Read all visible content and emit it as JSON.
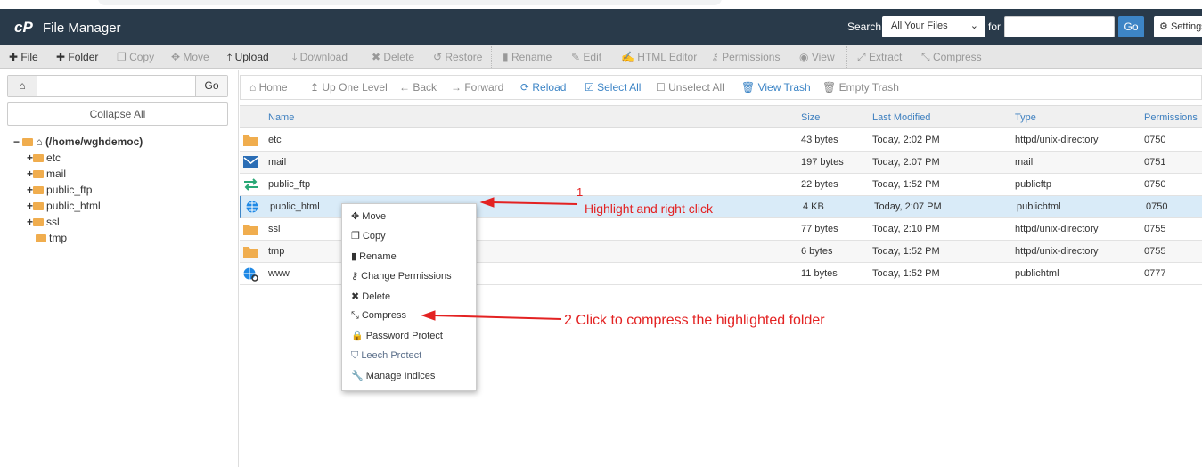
{
  "header": {
    "title": "File Manager",
    "logo": "cP",
    "search_label": "Search",
    "search_scope": "All Your Files",
    "for_label": "for",
    "search_value": "",
    "go": "Go",
    "settings": "Settings"
  },
  "toolbar": [
    {
      "icon": "plus-icon",
      "label": "File",
      "enabled": true
    },
    {
      "icon": "plus-icon",
      "label": "Folder",
      "enabled": true
    },
    {
      "icon": "copy-icon",
      "label": "Copy",
      "enabled": false
    },
    {
      "icon": "move-icon",
      "label": "Move",
      "enabled": false
    },
    {
      "icon": "upload-icon",
      "label": "Upload",
      "enabled": true
    },
    {
      "icon": "download-icon",
      "label": "Download",
      "enabled": false
    },
    {
      "icon": "delete-icon",
      "label": "Delete",
      "enabled": false
    },
    {
      "icon": "restore-icon",
      "label": "Restore",
      "enabled": false
    },
    {
      "icon": "rename-icon",
      "label": "Rename",
      "enabled": false
    },
    {
      "icon": "edit-icon",
      "label": "Edit",
      "enabled": false
    },
    {
      "icon": "html-editor-icon",
      "label": "HTML Editor",
      "enabled": false
    },
    {
      "icon": "key-icon",
      "label": "Permissions",
      "enabled": false
    },
    {
      "icon": "eye-icon",
      "label": "View",
      "enabled": false
    },
    {
      "icon": "extract-icon",
      "label": "Extract",
      "enabled": false
    },
    {
      "icon": "compress-icon",
      "label": "Compress",
      "enabled": false
    }
  ],
  "left": {
    "path_value": "",
    "go": "Go",
    "collapse_all": "Collapse All",
    "root": "(/home/wghdemoc)",
    "tree": [
      {
        "label": "etc",
        "expandable": true
      },
      {
        "label": "mail",
        "expandable": true
      },
      {
        "label": "public_ftp",
        "expandable": true
      },
      {
        "label": "public_html",
        "expandable": true
      },
      {
        "label": "ssl",
        "expandable": true
      },
      {
        "label": "tmp",
        "expandable": false
      }
    ]
  },
  "nav": [
    {
      "icon": "home-icon",
      "label": "Home"
    },
    {
      "icon": "up-icon",
      "label": "Up One Level"
    },
    {
      "icon": "back-icon",
      "label": "Back"
    },
    {
      "icon": "forward-icon",
      "label": "Forward"
    },
    {
      "icon": "reload-icon",
      "label": "Reload"
    },
    {
      "icon": "checkbox-checked-icon",
      "label": "Select All"
    },
    {
      "icon": "checkbox-icon",
      "label": "Unselect All"
    },
    {
      "icon": "trash-icon",
      "label": "View Trash"
    },
    {
      "icon": "trash-icon",
      "label": "Empty Trash"
    }
  ],
  "table": {
    "headers": [
      "Name",
      "Size",
      "Last Modified",
      "Type",
      "Permissions"
    ],
    "rows": [
      {
        "icon": "folder-icon",
        "name": "etc",
        "size": "43 bytes",
        "modified": "Today, 2:02 PM",
        "type": "httpd/unix-directory",
        "perms": "0750"
      },
      {
        "icon": "mail-icon",
        "name": "mail",
        "size": "197 bytes",
        "modified": "Today, 2:07 PM",
        "type": "mail",
        "perms": "0751"
      },
      {
        "icon": "transfer-icon",
        "name": "public_ftp",
        "size": "22 bytes",
        "modified": "Today, 1:52 PM",
        "type": "publicftp",
        "perms": "0750"
      },
      {
        "icon": "globe-icon",
        "name": "public_html",
        "size": "4 KB",
        "modified": "Today, 2:07 PM",
        "type": "publichtml",
        "perms": "0750",
        "selected": true
      },
      {
        "icon": "folder-icon",
        "name": "ssl",
        "size": "77 bytes",
        "modified": "Today, 2:10 PM",
        "type": "httpd/unix-directory",
        "perms": "0755"
      },
      {
        "icon": "folder-icon",
        "name": "tmp",
        "size": "6 bytes",
        "modified": "Today, 1:52 PM",
        "type": "httpd/unix-directory",
        "perms": "0755"
      },
      {
        "icon": "globe-link-icon",
        "name": "www",
        "size": "11 bytes",
        "modified": "Today, 1:52 PM",
        "type": "publichtml",
        "perms": "0777"
      }
    ]
  },
  "context_menu": [
    {
      "icon": "move-icon",
      "label": "Move"
    },
    {
      "icon": "copy-icon",
      "label": "Copy"
    },
    {
      "icon": "file-icon",
      "label": "Rename"
    },
    {
      "icon": "key-icon",
      "label": "Change Permissions"
    },
    {
      "icon": "delete-icon",
      "label": "Delete"
    },
    {
      "icon": "compress-icon",
      "label": "Compress"
    },
    {
      "icon": "lock-icon",
      "label": "Password Protect"
    },
    {
      "icon": "shield-icon",
      "label": "Leech Protect"
    },
    {
      "icon": "wrench-icon",
      "label": "Manage Indices"
    }
  ],
  "annotations": {
    "step1_number": "1",
    "step1_text": "Highlight and right click",
    "step2_text": "2 Click to compress the highlighted folder"
  },
  "colors": {
    "header_bg": "#293a4a",
    "accent": "#3d85c6",
    "selected_row": "#d9ebf8",
    "annotation": "#e32222",
    "folder": "#f0ad4e"
  }
}
